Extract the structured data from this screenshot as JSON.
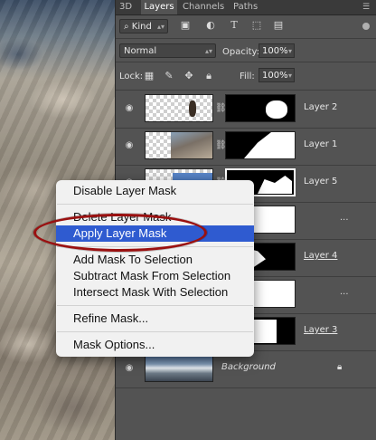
{
  "tabs": [
    "3D",
    "Layers",
    "Channels",
    "Paths"
  ],
  "active_tab": "Layers",
  "filter": {
    "label": "Kind",
    "icons": [
      "image-filter-icon",
      "adjustment-filter-icon",
      "type-filter-icon",
      "shape-filter-icon",
      "smart-object-filter-icon"
    ]
  },
  "blend": {
    "mode": "Normal",
    "opacity_label": "Opacity:",
    "opacity": "100%",
    "fill_label": "Fill:",
    "fill": "100%"
  },
  "lock": {
    "label": "Lock:"
  },
  "layers": [
    {
      "name": "Layer 2",
      "underline": false
    },
    {
      "name": "Layer 1",
      "underline": false
    },
    {
      "name": "Layer 5",
      "underline": false
    },
    {
      "name": "...",
      "underline": false
    },
    {
      "name": "Layer 4",
      "underline": true
    },
    {
      "name": "...",
      "underline": false
    },
    {
      "name": "Layer 3",
      "underline": true
    },
    {
      "name": "Background",
      "underline": false
    }
  ],
  "context_menu": {
    "items": [
      "Disable Layer Mask",
      "Delete Layer Mask",
      "Apply Layer Mask",
      "Add Mask To Selection",
      "Subtract Mask From Selection",
      "Intersect Mask With Selection",
      "Refine Mask...",
      "Mask Options..."
    ],
    "highlighted": "Apply Layer Mask"
  },
  "colors": {
    "panel": "#535353",
    "menu_highlight": "#2f5bd0",
    "annotation_oval": "#9a1010"
  }
}
